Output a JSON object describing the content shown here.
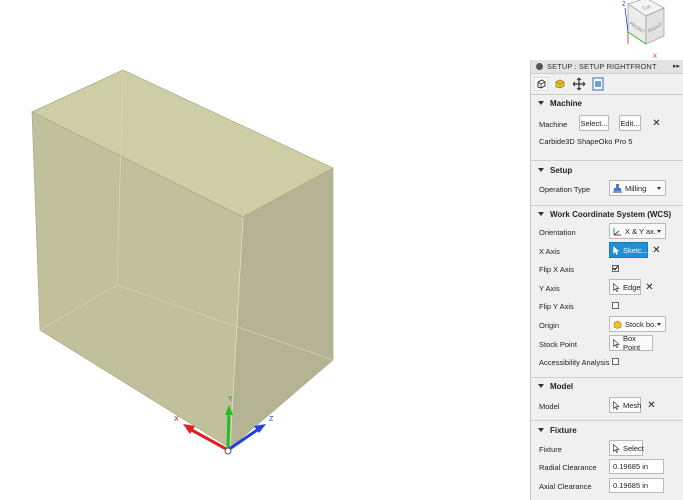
{
  "viewcube": {
    "top_label": "TOP",
    "front_label": "FRONT",
    "right_label": "RIGHT",
    "axis_x": "X",
    "axis_z": "Z"
  },
  "triad": {
    "x": "X",
    "y": "Y",
    "z": "Z"
  },
  "panel": {
    "title": "SETUP : SETUP RIGHTFRONT",
    "pin_icon": "expand-arrows-icon",
    "tabs": [
      "setup-tab-icon",
      "stock-tab-icon",
      "post-process-tab-icon",
      "info-tab-icon"
    ],
    "machine": {
      "header": "Machine",
      "label": "Machine",
      "select_button": "Select...",
      "edit_button": "Edit...",
      "machine_name": "Carbide3D ShapeOko Pro 5"
    },
    "setup": {
      "header": "Setup",
      "operation_type_label": "Operation Type",
      "operation_type_value": "Milling"
    },
    "wcs": {
      "header": "Work Coordinate System (WCS)",
      "orientation_label": "Orientation",
      "orientation_value": "X & Y ax...",
      "x_axis_label": "X Axis",
      "x_axis_value": "Sketc...",
      "flip_x_label": "Flip X Axis",
      "flip_x_checked": true,
      "y_axis_label": "Y Axis",
      "y_axis_value": "Edge",
      "flip_y_label": "Flip Y Axis",
      "flip_y_checked": false,
      "origin_label": "Origin",
      "origin_value": "Stock bo...",
      "stock_point_label": "Stock Point",
      "stock_point_value": "Box Point",
      "accessibility_label": "Accessibility Analysis",
      "accessibility_checked": false
    },
    "model": {
      "header": "Model",
      "label": "Model",
      "value": "Mesh"
    },
    "fixture": {
      "header": "Fixture",
      "label": "Fixture",
      "value": "Select",
      "radial_label": "Radial Clearance",
      "radial_value": "0.19685 in",
      "axial_label": "Axial Clearance",
      "axial_value": "0.19685 in"
    }
  },
  "colors": {
    "accent": "#1f8fd6",
    "stock_face_top": "#cfcfa6",
    "stock_face_side": "#b8b896",
    "axis_x": "#e02020",
    "axis_y": "#20c020",
    "axis_z": "#2040e0"
  }
}
